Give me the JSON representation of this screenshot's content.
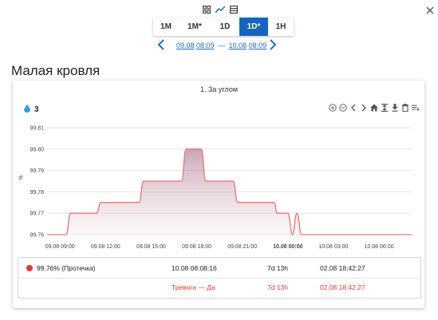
{
  "header": {
    "view_icons": [
      "grid-icon",
      "line-chart-icon",
      "table-icon"
    ],
    "period_tabs": [
      {
        "label": "1M",
        "active": false
      },
      {
        "label": "1M*",
        "active": false
      },
      {
        "label": "1D",
        "active": false
      },
      {
        "label": "1D*",
        "active": true
      },
      {
        "label": "1H",
        "active": false
      }
    ],
    "range": {
      "start_date": "09.08",
      "start_time": "08:09",
      "separator": "—",
      "end_date": "10.08",
      "end_time": "08:09"
    }
  },
  "page_title": "Малая кровля",
  "card": {
    "title": "1. За углом",
    "drop_count": "3",
    "toolbar_icons": [
      "zoom-in-icon",
      "zoom-out-icon",
      "pan-left-icon",
      "pan-right-icon",
      "home-icon",
      "zoom-fit-icon",
      "download-icon",
      "trash-icon",
      "menu-icon"
    ]
  },
  "chart_data": {
    "type": "line",
    "ylabel": "%",
    "ylim": [
      99.76,
      99.81
    ],
    "y_ticks": [
      "99.81",
      "99.80",
      "99.79",
      "99.78",
      "99.77",
      "99.76"
    ],
    "x_ticks": [
      {
        "label": "09.08 09:00",
        "bold": false
      },
      {
        "label": "09.08 12:00",
        "bold": false
      },
      {
        "label": "09.08 15:00",
        "bold": false
      },
      {
        "label": "09.08 18:00",
        "bold": false
      },
      {
        "label": "09.08 21:00",
        "bold": false
      },
      {
        "label": "10.08 00:00",
        "bold": true
      },
      {
        "label": "10.08 03:00",
        "bold": false
      },
      {
        "label": "10.08 06:00",
        "bold": false
      }
    ],
    "x_hours": [
      8.15,
      9.4,
      9.7,
      11.4,
      11.7,
      14.2,
      14.5,
      17.0,
      17.3,
      18.3,
      18.6,
      20.4,
      20.7,
      23.1,
      23.3,
      24.0,
      24.3,
      24.6,
      24.9,
      25.3,
      32.15
    ],
    "series": [
      {
        "values": [
          99.76,
          99.76,
          99.77,
          99.77,
          99.775,
          99.775,
          99.785,
          99.785,
          99.8,
          99.8,
          99.785,
          99.785,
          99.775,
          99.775,
          99.77,
          99.77,
          99.76,
          99.77,
          99.76,
          99.76,
          99.76
        ],
        "color": "#e57373"
      }
    ],
    "grid": true
  },
  "legend": {
    "row1": {
      "label": "99.76% (Протечка)",
      "time": "10.08 08:08:16",
      "duration": "7d 13h",
      "since": "02.08 18:42:27"
    },
    "row2": {
      "status": "Тревога — Да",
      "duration": "7d 13h",
      "since": "02.08 18:42:27"
    }
  }
}
